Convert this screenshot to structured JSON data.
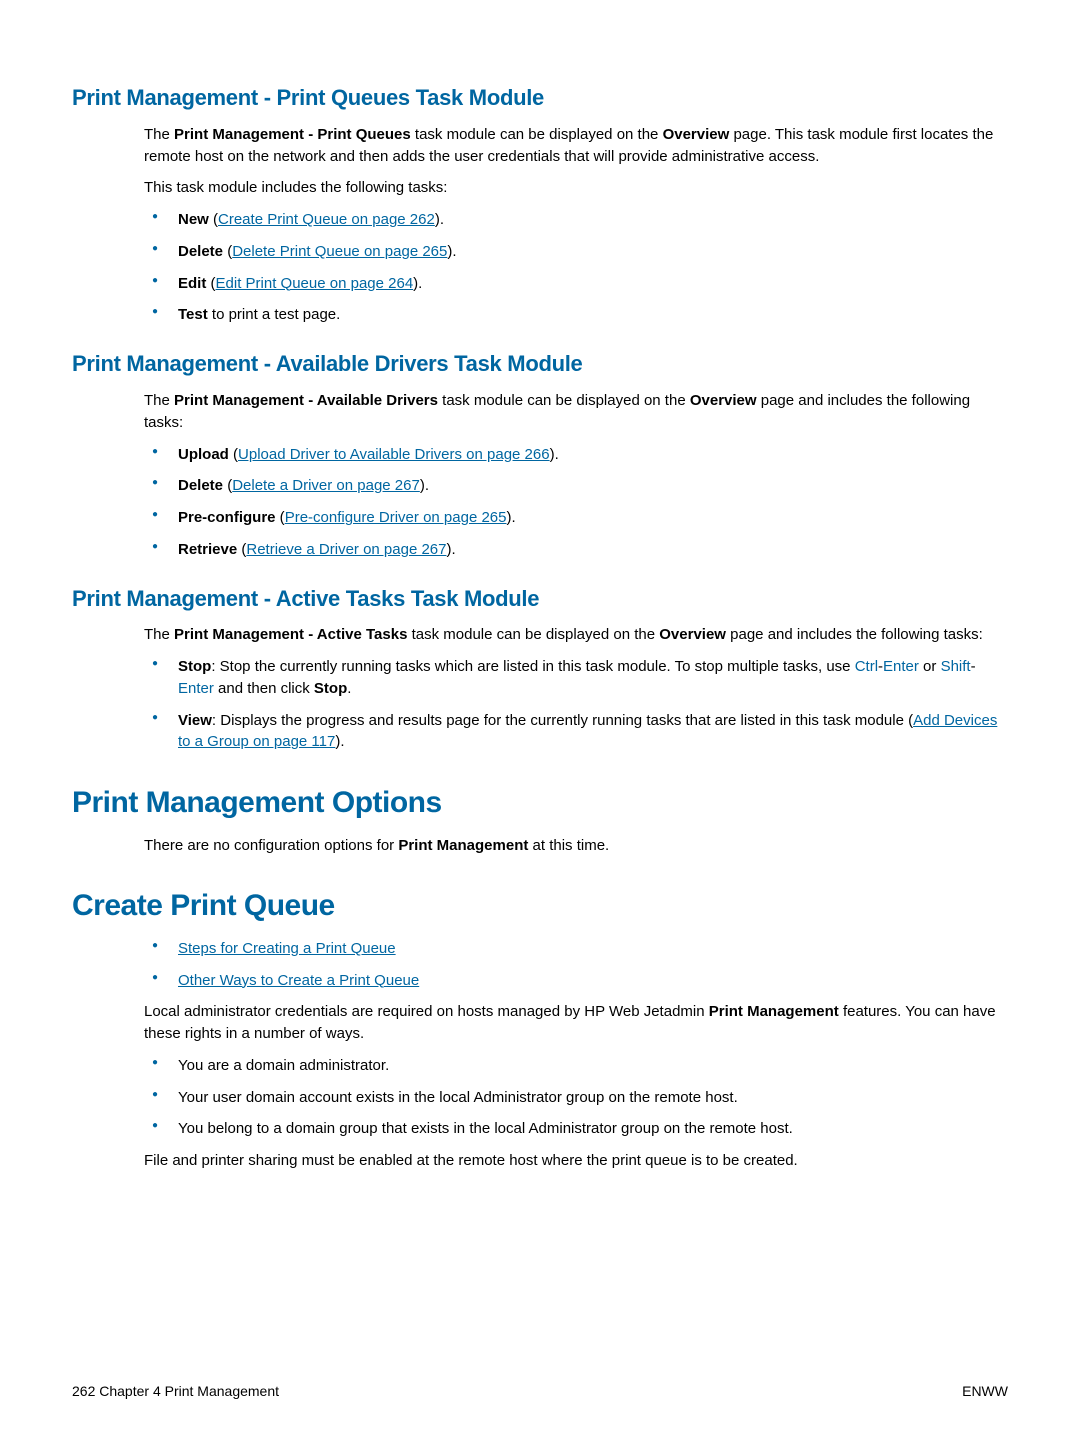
{
  "sections": {
    "print_queues": {
      "heading": "Print Management - Print Queues Task Module",
      "para1_pre": "The ",
      "para1_bold1": "Print Management - Print Queues",
      "para1_mid": " task module can be displayed on the ",
      "para1_bold2": "Overview",
      "para1_post": " page. This task module first locates the remote host on the network and then adds the user credentials that will provide administrative access.",
      "para2": "This task module includes the following tasks:",
      "items": {
        "new_label": "New",
        "new_link": "Create Print Queue on page 262",
        "delete_label": "Delete",
        "delete_link": "Delete Print Queue on page 265",
        "edit_label": "Edit",
        "edit_link": "Edit Print Queue on page 264",
        "test_label": "Test",
        "test_post": " to print a test page."
      }
    },
    "available_drivers": {
      "heading": "Print Management - Available Drivers Task Module",
      "para_pre": "The ",
      "para_bold1": "Print Management - Available Drivers",
      "para_mid": " task module can be displayed on the ",
      "para_bold2": "Overview",
      "para_post": " page and includes the following tasks:",
      "items": {
        "upload_label": "Upload",
        "upload_link": "Upload Driver to Available Drivers on page 266",
        "delete_label": "Delete",
        "delete_link": "Delete a Driver on page 267",
        "precfg_label": "Pre-configure",
        "precfg_link": "Pre-configure Driver on page 265",
        "retrieve_label": "Retrieve",
        "retrieve_link": "Retrieve a Driver on page 267"
      }
    },
    "active_tasks": {
      "heading": "Print Management - Active Tasks Task Module",
      "para_pre": "The ",
      "para_bold1": "Print Management - Active Tasks",
      "para_mid": " task module can be displayed on the ",
      "para_bold2": "Overview",
      "para_post": " page and includes the following tasks:",
      "items": {
        "stop_label": "Stop",
        "stop_text1": ": Stop the currently running tasks which are listed in this task module. To stop multiple tasks, use ",
        "ctrl": "Ctrl",
        "dash": "-",
        "enter": "Enter",
        "or": " or ",
        "shift": "Shift",
        "stop_text2": " and then click ",
        "stop_bold": "Stop",
        "stop_text3": ".",
        "view_label": "View",
        "view_text1": ": Displays the progress and results page for the currently running tasks that are listed in this task module (",
        "view_link": "Add Devices to a Group on page 117",
        "view_text2": ")."
      }
    },
    "options": {
      "heading": "Print Management Options",
      "para_pre": "There are no configuration options for ",
      "para_bold": "Print Management",
      "para_post": " at this time."
    },
    "create_queue": {
      "heading": "Create Print Queue",
      "link_steps": "Steps for Creating a Print Queue",
      "link_other": "Other Ways to Create a Print Queue",
      "para_pre": "Local administrator credentials are required on hosts managed by HP Web Jetadmin ",
      "para_bold": "Print Management",
      "para_post": " features. You can have these rights in a number of ways.",
      "bullet1": "You are a domain administrator.",
      "bullet2": "Your user domain account exists in the local Administrator group on the remote host.",
      "bullet3": "You belong to a domain group that exists in the local Administrator group on the remote host.",
      "para_final": "File and printer sharing must be enabled at the remote host where the print queue is to be created."
    }
  },
  "footer": {
    "left": "262   Chapter 4   Print Management",
    "right": "ENWW"
  }
}
